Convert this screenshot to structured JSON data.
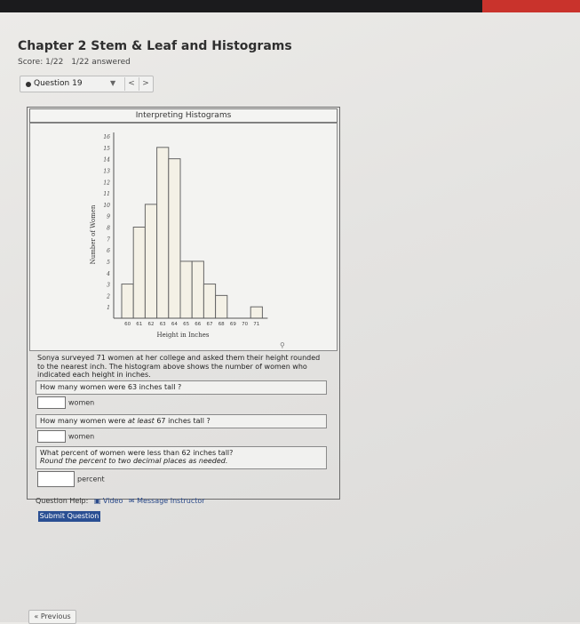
{
  "page": {
    "title": "Chapter 2 Stem & Leaf and Histograms",
    "score": "Score: 1/22",
    "answered": "1/22 answered"
  },
  "question_nav": {
    "selected": "Question 19",
    "prev": "<",
    "next": ">"
  },
  "problem": {
    "header": "Interpreting Histograms",
    "description": "Sonya surveyed 71 women at her college and asked them their height rounded to the nearest inch. The histogram above shows the number of women who indicated each height in inches.",
    "q1": "How many women were 63 inches tall ?",
    "q1_unit": "women",
    "q2_pre": "How many women were ",
    "q2_em": "at least",
    "q2_post": " 67 inches tall ?",
    "q2_unit": "women",
    "q3": "What percent of women were less than 62 inches tall?",
    "q3_instr": "Round the percent to two decimal places as needed.",
    "q3_unit": "percent"
  },
  "footer": {
    "help_label": "Question Help:",
    "video": "Video",
    "message": "Message Instructor",
    "submit": "Submit Question",
    "previous": "« Previous"
  },
  "chart_data": {
    "type": "bar",
    "xlabel": "Height in Inches",
    "ylabel": "Number of Women",
    "categories": [
      "60",
      "61",
      "62",
      "63",
      "64",
      "65",
      "66",
      "67",
      "68",
      "69",
      "70",
      "71"
    ],
    "values": [
      3,
      8,
      10,
      15,
      14,
      5,
      5,
      3,
      2,
      0,
      0,
      1
    ],
    "ylim": [
      0,
      16
    ],
    "yticks": [
      "1",
      "2",
      "3",
      "4",
      "5",
      "6",
      "7",
      "8",
      "9",
      "10",
      "11",
      "12",
      "13",
      "14",
      "15",
      "16"
    ],
    "bar_fill": "#f4f1e6",
    "bar_stroke": "#666666",
    "grid": false
  }
}
